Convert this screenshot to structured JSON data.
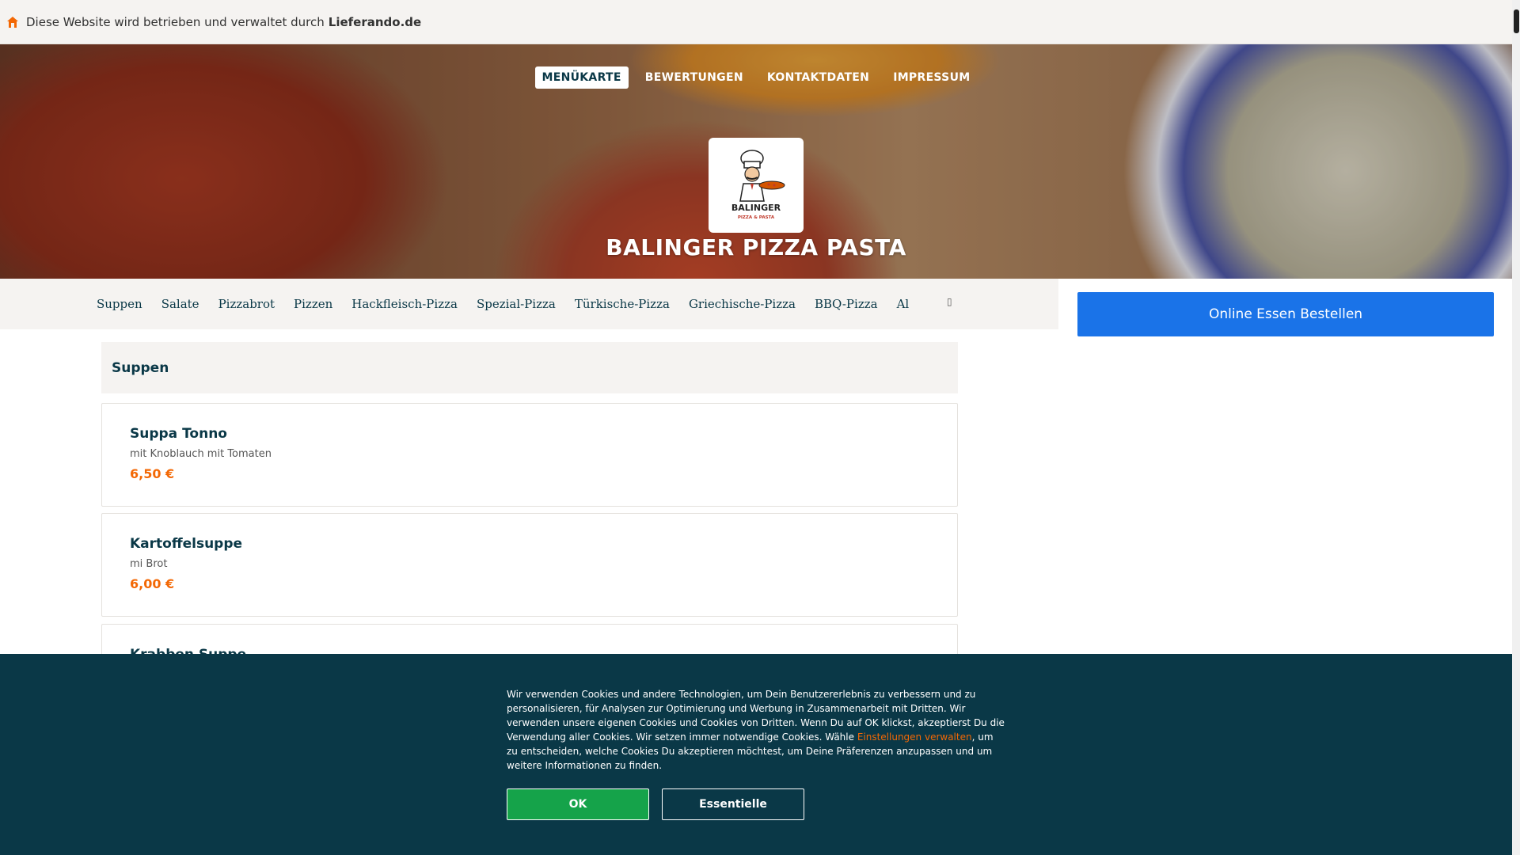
{
  "info_bar": {
    "text": "Diese Website wird betrieben und verwaltet durch",
    "brand": "Lieferando.de",
    "icon": "house-icon"
  },
  "nav": {
    "items": [
      {
        "label": "MENÜKARTE",
        "active": true
      },
      {
        "label": "BEWERTUNGEN",
        "active": false
      },
      {
        "label": "KONTAKTDATEN",
        "active": false
      },
      {
        "label": "IMPRESSUM",
        "active": false
      }
    ]
  },
  "restaurant": {
    "name": "BALINGER PIZZA PASTA",
    "logo_text": "BALINGER",
    "logo_subtext": "PIZZA & PASTA"
  },
  "categories": [
    "Suppen",
    "Salate",
    "Pizzabrot",
    "Pizzen",
    "Hackfleisch-Pizza",
    "Spezial-Pizza",
    "Türkische-Pizza",
    "Griechische-Pizza",
    "BBQ-Pizza",
    "Al"
  ],
  "order_button": "Online Essen Bestellen",
  "menu": {
    "section_title": "Suppen",
    "items": [
      {
        "name": "Suppa Tonno",
        "description": "mit Knoblauch mit Tomaten",
        "price": "6,50 €"
      },
      {
        "name": "Kartoffelsuppe",
        "description": "mi Brot",
        "price": "6,00 €"
      },
      {
        "name": "Krabben Suppe",
        "description": "",
        "price": ""
      }
    ]
  },
  "cookie": {
    "text_before": "Wir verwenden Cookies und andere Technologien, um Dein Benutzererlebnis zu verbessern und zu personalisieren, für Analysen zur Optimierung und Werbung in Zusammenarbeit mit Dritten. Wir verwenden unsere eigenen Cookies und Cookies von Dritten. Wenn Du auf OK klickst, akzeptierst Du die Verwendung aller Cookies. Wir setzen immer notwendige Cookies. Wähle ",
    "link": "Einstellungen verwalten",
    "text_after": ", um zu entscheiden, welche Cookies Du akzeptieren möchtest, um Deine Präferenzen anzupassen und um weitere Informationen zu finden.",
    "ok_label": "OK",
    "essential_label": "Essentielle"
  },
  "colors": {
    "accent": "#f36805",
    "dark": "#0a3847",
    "order_blue": "#1a73e8",
    "ok_green": "#15a34a"
  }
}
